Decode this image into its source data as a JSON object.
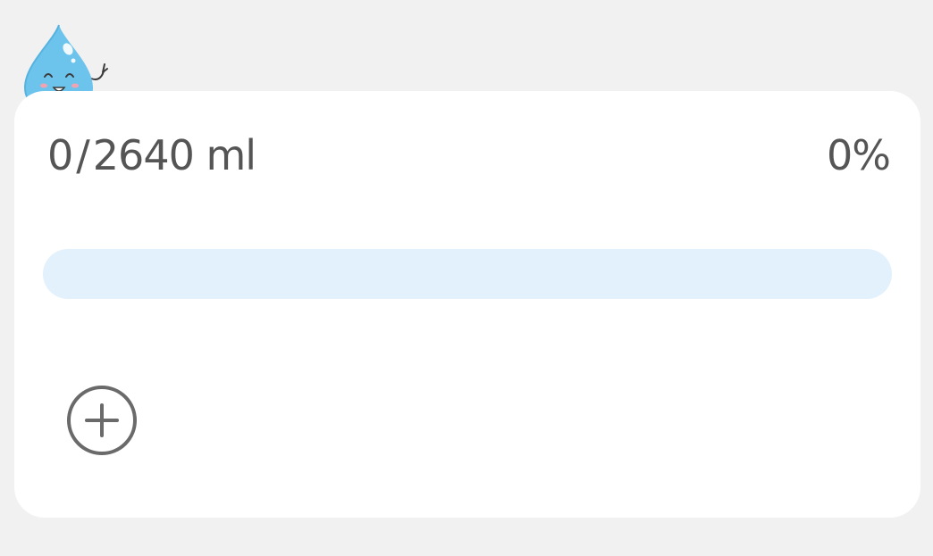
{
  "hydration": {
    "consumed": "0",
    "separator": "/",
    "goal": "2640 ml",
    "percent_label": "0%",
    "progress_fraction": 0
  },
  "colors": {
    "background": "#f1f1f2",
    "card": "#ffffff",
    "text": "#555555",
    "progress_track": "#e3f1fc",
    "progress_fill": "#7fc6f0",
    "icon_stroke": "#6a6a6a",
    "mascot_body": "#6cc3ec"
  },
  "icons": {
    "mascot": "water-drop-mascot-icon",
    "add": "plus-circle-icon"
  }
}
